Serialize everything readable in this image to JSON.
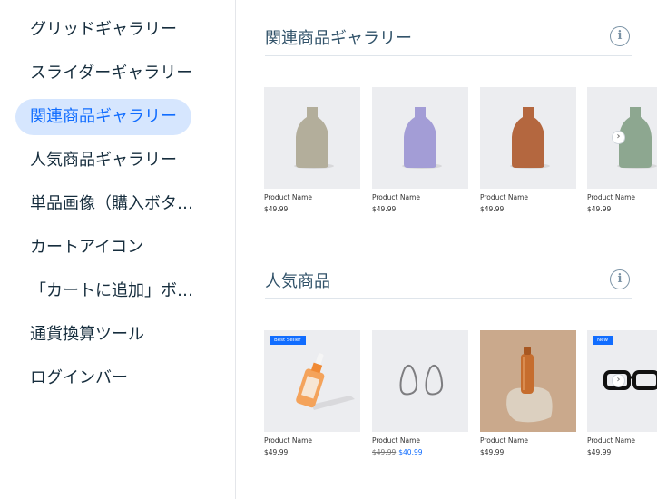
{
  "sidebar": {
    "items": [
      {
        "label": "グリッドギャラリー"
      },
      {
        "label": "スライダーギャラリー"
      },
      {
        "label": "関連商品ギャラリー"
      },
      {
        "label": "人気商品ギャラリー"
      },
      {
        "label": "単品画像（購入ボタン付き）"
      },
      {
        "label": "カートアイコン"
      },
      {
        "label": "「カートに追加」ボタン"
      },
      {
        "label": "通貨換算ツール"
      },
      {
        "label": "ログインバー"
      }
    ],
    "selected": "関連商品ギャラリー"
  },
  "sections": [
    {
      "title": "関連商品ギャラリー",
      "info_icon": "info-icon",
      "products": [
        {
          "name": "Product Name",
          "price": "$49.99",
          "image": "vase-beige"
        },
        {
          "name": "Product Name",
          "price": "$49.99",
          "image": "vase-lavender"
        },
        {
          "name": "Product Name",
          "price": "$49.99",
          "image": "vase-terracotta"
        },
        {
          "name": "Product Name",
          "price": "$49.99",
          "image": "vase-sage"
        }
      ]
    },
    {
      "title": "人気商品",
      "info_icon": "info-icon",
      "products": [
        {
          "name": "Product Name",
          "price": "$49.99",
          "badge": "Best Seller",
          "image": "serum-bottle"
        },
        {
          "name": "Product Name",
          "price": "$49.99",
          "sale_price": "$40.99",
          "image": "hoop-earrings"
        },
        {
          "name": "Product Name",
          "price": "$49.99",
          "image": "water-bottle"
        },
        {
          "name": "Product Name",
          "price": "$49.99",
          "badge": "New",
          "image": "glasses"
        }
      ]
    }
  ],
  "colors": {
    "accent": "#116dff",
    "selected_bg": "#d6e6fe",
    "text": "#162d3d",
    "card_bg": "#ecedf0"
  }
}
